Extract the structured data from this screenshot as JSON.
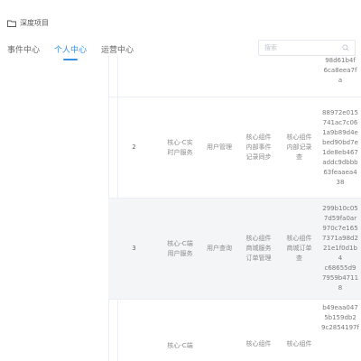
{
  "breadcrumb": {
    "label": "深度项目",
    "icon": "folder-icon"
  },
  "tabs": [
    {
      "label": "事件中心",
      "active": false
    },
    {
      "label": "个人中心",
      "active": true
    },
    {
      "label": "运营中心",
      "active": false
    }
  ],
  "search": {
    "placeholder": "搜索",
    "value": ""
  },
  "colors": {
    "accent": "#3a8ee6",
    "row_shade": "#f4f5f7",
    "border": "#ebeef5"
  },
  "table": {
    "rows": [
      {
        "index": "",
        "name": "",
        "category": "",
        "col_a": "",
        "col_b": "",
        "hash": "98d61b4f\n6ca8eea7f\na"
      },
      {
        "index": "2",
        "name": "核心-C实\n时户服务",
        "category": "用户管理",
        "col_a": "核心组件\n内部事件\n记录同步",
        "col_b": "核心组件\n内部记录\n查",
        "hash": "88972e015\n741ac7c06\n1a9b89d4e\nbed90bd7e\n1de8eb467\naddc9dbbb\n63feaaea4\n38"
      },
      {
        "index": "3",
        "name": "核心-C端\n用户服务",
        "category": "用户查询",
        "col_a": "核心组件\n商城服务\n订单管理",
        "col_b": "核心组件\n商城订单\n查",
        "hash": "299b10c05\n7d59fa0ar\n970c7e165\n7371a98d2\n21e1f0d1b4\nc68655d9\n7959b4711\n8"
      },
      {
        "index": "",
        "name": "核心-C端",
        "category": "",
        "col_a": "核心组件",
        "col_b": "核心组件",
        "hash": "b49eaa047\n5b159db2\n9c2854197f"
      }
    ]
  }
}
